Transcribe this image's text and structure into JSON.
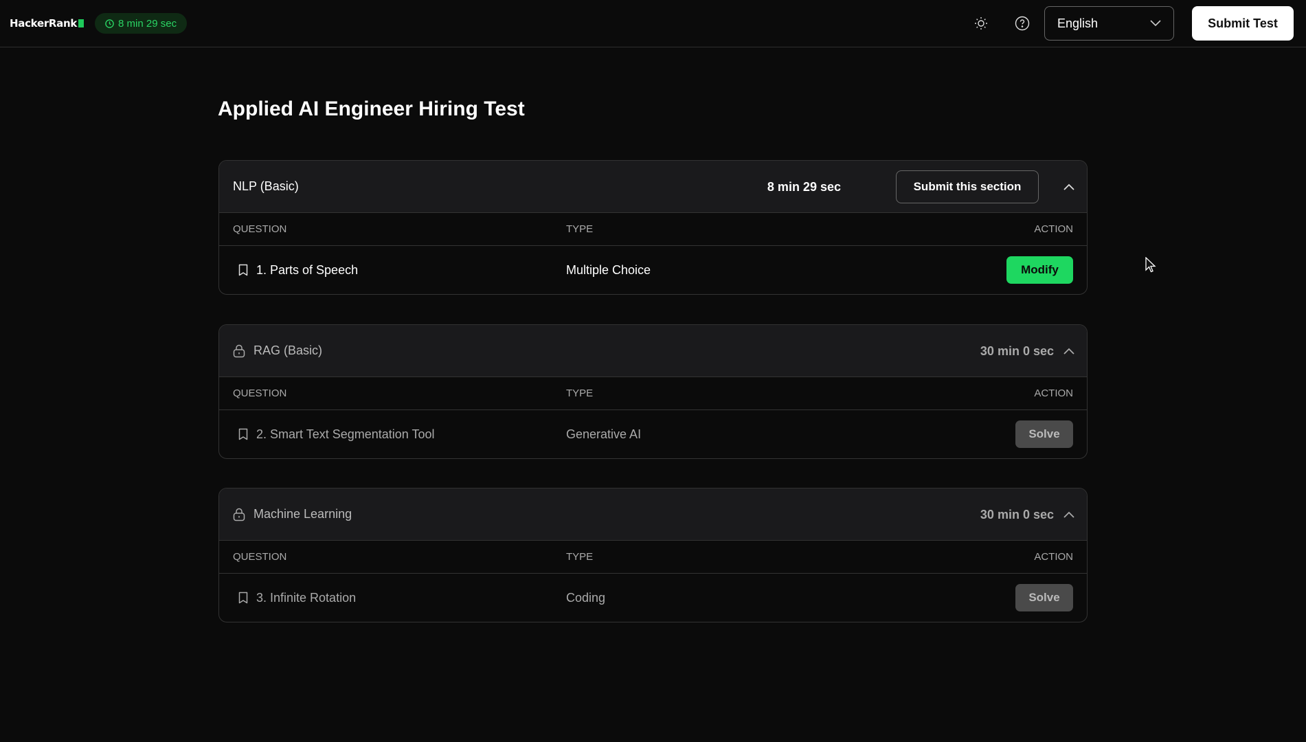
{
  "header": {
    "logo": "HackerRank",
    "timer": "8 min 29 sec",
    "language": "English",
    "submit_label": "Submit Test"
  },
  "title": "Applied AI Engineer Hiring Test",
  "columns": {
    "question": "QUESTION",
    "type": "TYPE",
    "action": "ACTION"
  },
  "sections": [
    {
      "name": "NLP (Basic)",
      "time": "8 min 29 sec",
      "submit_label": "Submit this section",
      "locked": false,
      "question": "1. Parts of Speech",
      "type": "Multiple Choice",
      "action": "Modify"
    },
    {
      "name": "RAG (Basic)",
      "time": "30 min 0 sec",
      "locked": true,
      "question": "2. Smart Text Segmentation Tool",
      "type": "Generative AI",
      "action": "Solve"
    },
    {
      "name": "Machine Learning",
      "time": "30 min 0 sec",
      "locked": true,
      "question": "3. Infinite Rotation",
      "type": "Coding",
      "action": "Solve"
    }
  ],
  "colors": {
    "accent": "#1ed760",
    "background": "#0b0b0b",
    "card_header": "#1a1a1c"
  }
}
